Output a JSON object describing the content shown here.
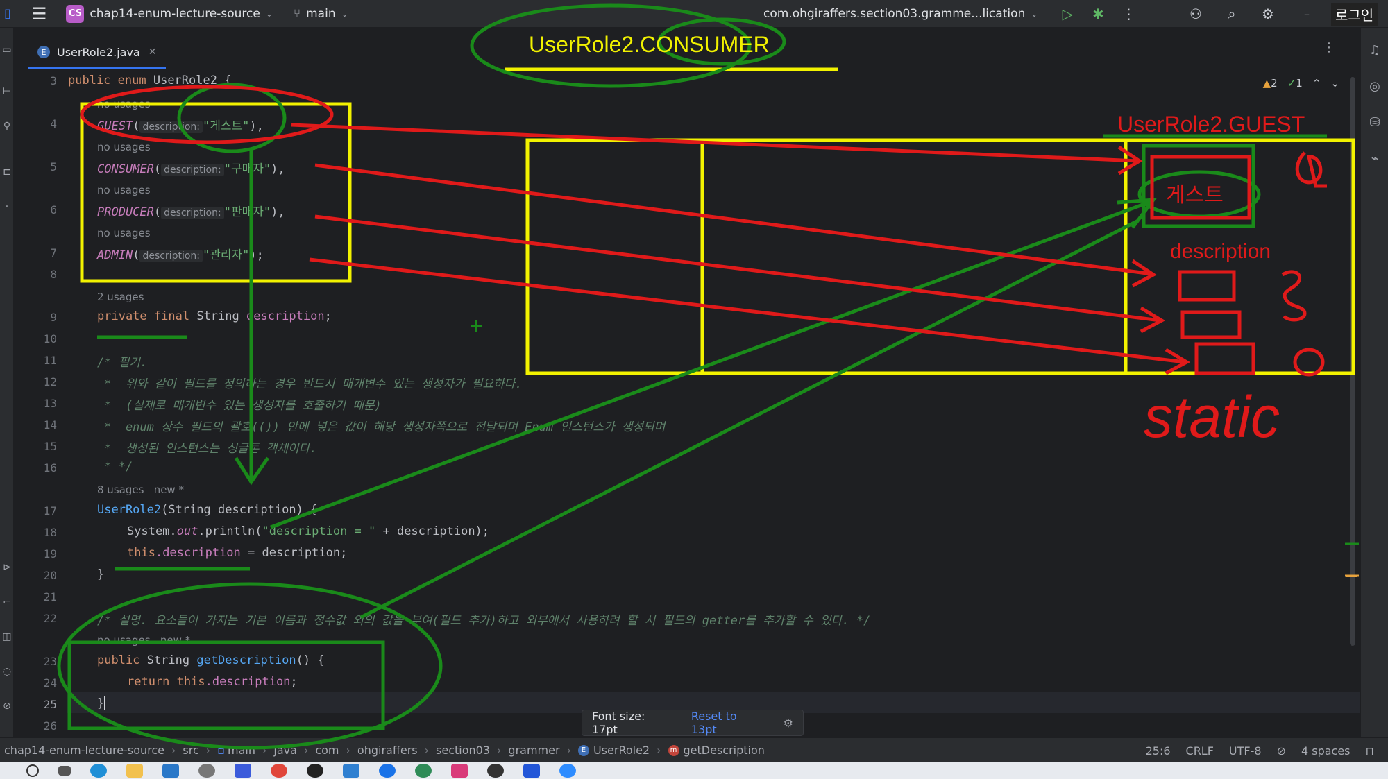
{
  "topbar": {
    "project_badge": "CS",
    "project_name": "chap14-enum-lecture-source",
    "branch": "main",
    "run_config": "com.ohgiraffers.section03.gramme...lication",
    "login_label": "로그인"
  },
  "tab": {
    "label": "UserRole2.java",
    "icon": "E"
  },
  "inspection": {
    "warnings": "2",
    "checks": "1"
  },
  "gutter": {
    "line_numbers": [
      "3",
      "4",
      "5",
      "6",
      "7",
      "8",
      "9",
      "10",
      "11",
      "12",
      "13",
      "14",
      "15",
      "16",
      "17",
      "18",
      "19",
      "20",
      "21",
      "22",
      "23",
      "24",
      "25",
      "26"
    ]
  },
  "code": {
    "l3_kw": "public enum",
    "l3_name": "UserRole2 {",
    "hint_usage": "no usages",
    "l4_const": "GUEST",
    "param_name": "description:",
    "l4_val": "\"게스트\"",
    "l5_const": "CONSUMER",
    "l5_val": "\"구매자\"",
    "l6_const": "PRODUCER",
    "l6_val": "\"판매자\"",
    "l7_const": "ADMIN",
    "l7_val": "\"관리자\"",
    "hint_2usages": "2 usages",
    "l9_kw": "private final",
    "l9_type": "String",
    "l9_field": "description",
    "l11": "/* 필기.",
    "l12": " *  위와 같이 필드를 정의하는 경우 반드시 매개변수 있는 생성자가 필요하다.",
    "l13": " *  (실제로 매개변수 있는 생성자를 호출하기 때문)",
    "l14": " *  enum 상수 필드의 괄호(()) 안에 넣은 값이 해당 생성자쪽으로 전달되며 Enum 인스턴스가 생성되며",
    "l15": " *  생성된 인스턴스는 싱글톤 객체이다.",
    "l16": " * */",
    "hint_8usages": "8 usages   new *",
    "l17_ctor": "UserRole2",
    "l17_rest": "(String description) {",
    "l18_a": "System.",
    "l18_out": "out",
    "l18_b": ".println(",
    "l18_str": "\"description = \"",
    "l18_c": " + description);",
    "l19_this": "this",
    "l19_field": ".description",
    "l19_rest": " = description;",
    "l20": "}",
    "l22": "/* 설명. 요소들이 가지는 기본 이름과 정수값 외의 값을 부여(필드 추가)하고 외부에서 사용하려 할 시 필드의 getter를 추가할 수 있다. */",
    "hint_nousages_new": "no usages   new *",
    "l23_kw": "public",
    "l23_type": "String",
    "l23_fn": "getDescription",
    "l23_rest": "() {",
    "l24_kw": "return this",
    "l24_field": ".description",
    "l24_rest": ";",
    "l25": "}"
  },
  "font_popup": {
    "label": "Font size: 17pt",
    "reset": "Reset to 13pt"
  },
  "breadcrumbs": [
    "chap14-enum-lecture-source",
    "src",
    "main",
    "java",
    "com",
    "ohgiraffers",
    "section03",
    "grammer",
    "UserRole2",
    "getDescription"
  ],
  "status": {
    "position": "25:6",
    "line_sep": "CRLF",
    "encoding": "UTF-8",
    "indent": "4 spaces"
  },
  "annotations": {
    "consumer": "UserRole2.CONSUMER",
    "guest": "UserRole2.GUEST",
    "guest_value": "게스트",
    "description": "description",
    "static": "static"
  },
  "colors": {
    "accent": "#3574f0",
    "annot_red": "#e01a1a",
    "annot_green": "#1a8a1a",
    "annot_yellow": "#f2f200"
  }
}
